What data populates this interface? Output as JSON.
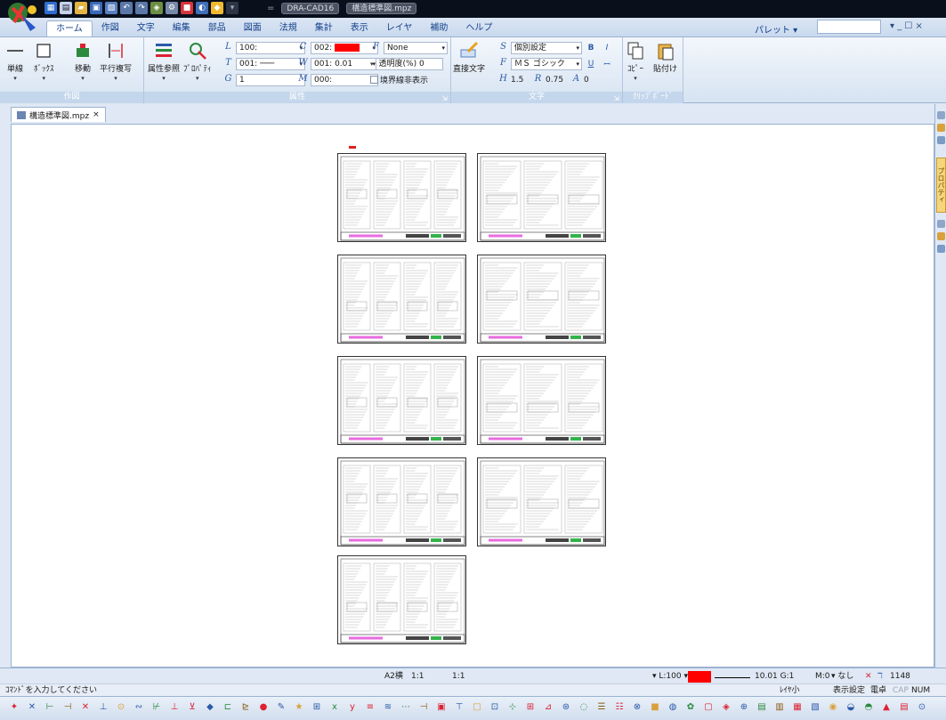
{
  "titlebar": {
    "app_title": "DRA-CAD16",
    "document_title": "構造標準図.mpz"
  },
  "ribbon_tabs": [
    {
      "label": "ホーム",
      "active": true
    },
    {
      "label": "作図"
    },
    {
      "label": "文字"
    },
    {
      "label": "編集"
    },
    {
      "label": "部品"
    },
    {
      "label": "図面"
    },
    {
      "label": "法規"
    },
    {
      "label": "集計"
    },
    {
      "label": "表示"
    },
    {
      "label": "レイヤ"
    },
    {
      "label": "補助"
    },
    {
      "label": "ヘルプ"
    }
  ],
  "palette_label": "パレット ▾",
  "window_controls": "▾ _ ☐ ×",
  "groups": {
    "draw": {
      "label": "作図",
      "buttons": [
        {
          "label": "単線",
          "icon": "line-icon"
        },
        {
          "label": "ﾎﾞｯｸｽ",
          "icon": "box-icon"
        },
        {
          "label": "移動",
          "icon": "move-icon"
        },
        {
          "label": "平行複写",
          "icon": "parallel-copy-icon"
        }
      ]
    },
    "attributes": {
      "label": "属性",
      "buttons": [
        {
          "label": "属性参照",
          "icon": "attribute-ref-icon"
        },
        {
          "label": "ﾌﾟﾛﾊﾟﾃｨ",
          "icon": "properties-icon"
        }
      ],
      "line_type": "100:",
      "line_style": "001:",
      "group": "1",
      "color": "002:",
      "color_hex": "#ff0000",
      "width": "001: 0.01",
      "layer": "000:",
      "fill": "None",
      "transparency": "透明度(%) 0",
      "boundary": "境界線非表示"
    },
    "text": {
      "label": "文字",
      "direct_text": "直接文字",
      "style": "個別設定",
      "font": "ＭＳ ゴシック",
      "size": "1.5",
      "ratio": "0.75",
      "angle": "0",
      "bold": "B",
      "italic": "I",
      "underline": "U"
    },
    "clipboard": {
      "label": "ｸﾘｯﾌﾟﾎﾞｰﾄﾞ",
      "copy": "ｺﾋﾟｰ",
      "paste": "貼付け"
    }
  },
  "document_tab": {
    "label": "構造標準図.mpz",
    "close": "×"
  },
  "right_dock_tab": "プロパティ",
  "status": {
    "paper": "A2横",
    "scale": "1:1",
    "ratio": "1:1",
    "line_label": "▾ L:100 ▾",
    "line_width": "10.01 G:1",
    "layer": "M:0",
    "mode_label": "▾ なし",
    "count": "1148",
    "command_prompt": "ｺﾏﾝﾄﾞを入力してください",
    "layer_small": "ﾚｲﾔ小",
    "display_settings": "表示設定",
    "magnet": "電卓",
    "caps": "CAP",
    "num": "NUM"
  }
}
